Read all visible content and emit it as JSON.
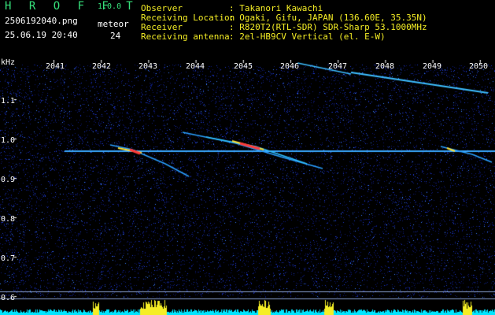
{
  "app": {
    "title": "H R O F F T",
    "version": "1.0.0",
    "filename": "2506192040.png",
    "timestamp": "25.06.19 20:40",
    "meteor_label": "meteor",
    "meteor_count": "24"
  },
  "info": [
    {
      "label": "Observer",
      "value": ": Takanori Kawachi"
    },
    {
      "label": "Receiving Location",
      "value": ": Ogaki, Gifu, JAPAN (136.60E, 35.35N)"
    },
    {
      "label": "Receiver",
      "value": ": R820T2(RTL-SDR) SDR-Sharp 53.1000MHz"
    },
    {
      "label": "Receiving antenna",
      "value": ": 2el-HB9CV Vertical (el. E-W)"
    }
  ],
  "spectrogram": {
    "y_unit": "kHz",
    "x_ticks": [
      "2041",
      "2042",
      "2043",
      "2044",
      "2045",
      "2046",
      "2047",
      "2048",
      "2049",
      "2050"
    ],
    "y_ticks": [
      "1.1",
      "1.0",
      "0.9",
      "0.8",
      "0.7",
      "0.6"
    ]
  },
  "colors": {
    "background": "#000000",
    "noise": "#1a2aa8",
    "carrier": "#3aa8ff",
    "meteor_hot": "#ff3a3a",
    "meteor_mid": "#ffe033",
    "activity": "#00e5ff",
    "activity_peak": "#f5ee25",
    "header_green": "#36e07a",
    "header_yellow": "#f5ee25"
  }
}
